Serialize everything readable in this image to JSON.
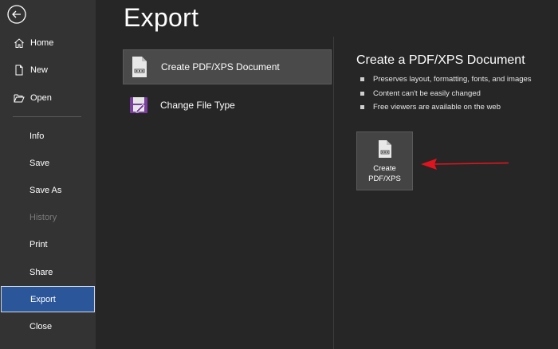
{
  "sidebar": {
    "items": [
      {
        "label": "Home",
        "icon": "home-icon"
      },
      {
        "label": "New",
        "icon": "new-document-icon"
      },
      {
        "label": "Open",
        "icon": "open-folder-icon"
      },
      {
        "label": "Info"
      },
      {
        "label": "Save"
      },
      {
        "label": "Save As"
      },
      {
        "label": "History",
        "disabled": true
      },
      {
        "label": "Print"
      },
      {
        "label": "Share"
      },
      {
        "label": "Export",
        "active": true
      },
      {
        "label": "Close"
      }
    ]
  },
  "page": {
    "title": "Export"
  },
  "options": [
    {
      "label": "Create PDF/XPS Document",
      "icon": "pdf-document-icon",
      "selected": true
    },
    {
      "label": "Change File Type",
      "icon": "change-file-type-icon"
    }
  ],
  "detail": {
    "title": "Create a PDF/XPS Document",
    "bullets": [
      "Preserves layout, formatting, fonts, and images",
      "Content can't be easily changed",
      "Free viewers are available on the web"
    ],
    "button_line1": "Create",
    "button_line2": "PDF/XPS"
  },
  "colors": {
    "sidebar_bg": "#333333",
    "main_bg": "#262626",
    "active_nav": "#2b579a",
    "annotation_arrow": "#e0141e"
  }
}
